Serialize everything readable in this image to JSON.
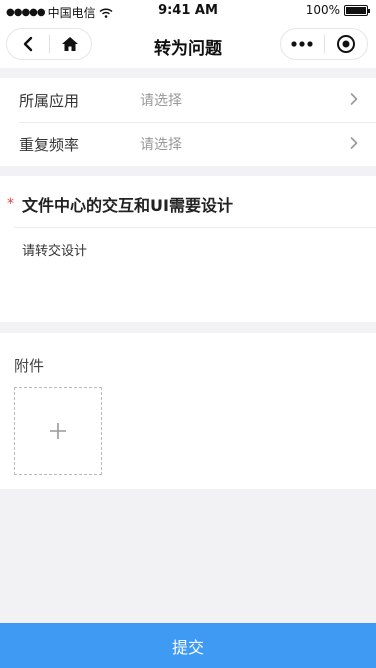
{
  "status_bar": {
    "signal": "●●●●●",
    "carrier": "中国电信",
    "time": "9:41 AM",
    "battery": "100%"
  },
  "nav": {
    "title": "转为问题",
    "back_icon": "chevron-left-icon",
    "home_icon": "home-icon",
    "more_icon": "more-dots-icon",
    "close_icon": "target-close-icon"
  },
  "form": {
    "rows": [
      {
        "label": "所属应用",
        "placeholder": "请选择"
      },
      {
        "label": "重复频率",
        "placeholder": "请选择"
      }
    ]
  },
  "issue": {
    "required_mark": "*",
    "title": "文件中心的交互和UI需要设计",
    "description": "请转交设计"
  },
  "attachment": {
    "label": "附件",
    "add_icon": "plus-icon"
  },
  "submit_label": "提交",
  "colors": {
    "accent": "#3e9af3",
    "required": "#e64340",
    "background": "#f2f2f5"
  }
}
